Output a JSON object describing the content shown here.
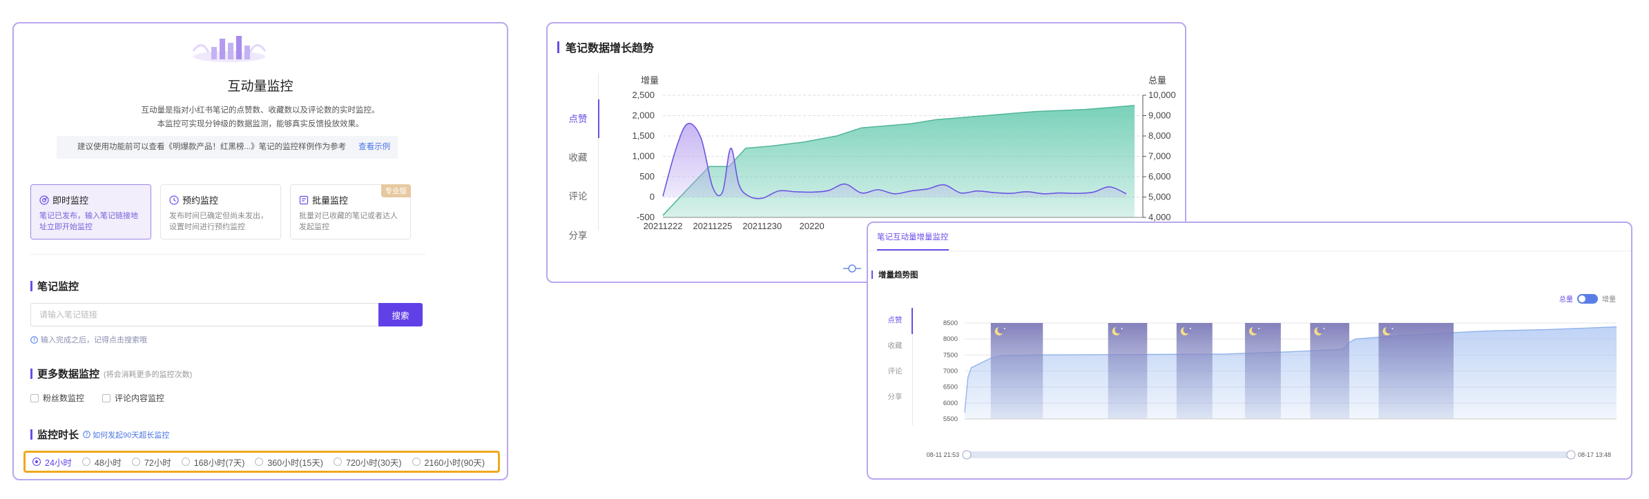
{
  "colors": {
    "accent": "#6240e8",
    "border": "#b9a6ee",
    "highlight": "#f0a81e",
    "link": "#4a76e6",
    "teal": "#5bbfa6"
  },
  "left": {
    "logo_icon": "bar-chart-logo-icon",
    "title": "互动量监控",
    "desc1": "互动量是指对小红书笔记的点赞数、收藏数以及评论数的实时监控。",
    "desc2": "本监控可实现分钟级的数据监测，能够真实反馈投放效果。",
    "tip": "建议使用功能前可以查看《明爆款产品！红黑榜...》笔记的监控样例作为参考",
    "tip_link": "查看示例",
    "modes": [
      {
        "title": "即时监控",
        "desc1": "笔记已发布，输入笔记链接地",
        "desc2": "址立即开始监控",
        "icon": "radar-icon"
      },
      {
        "title": "预约监控",
        "desc1": "发布时间已确定但尚未发出，",
        "desc2": "设置时间进行预约监控",
        "icon": "clock-icon"
      },
      {
        "title": "批量监控",
        "desc1": "批量对已收藏的笔记或者达人",
        "desc2": "发起监控",
        "icon": "batch-icon",
        "badge": "专业版"
      }
    ],
    "note_section": "笔记监控",
    "search_placeholder": "请输入笔记链接",
    "search_button": "搜索",
    "search_hint": "输入完成之后，记得点击搜索哦",
    "more_section": "更多数据监控",
    "more_sub": "(将会消耗更多的监控次数)",
    "checks": [
      "粉丝数监控",
      "评论内容监控"
    ],
    "duration_section": "监控时长",
    "duration_help": "如何发起90天超长监控",
    "durations": [
      "24小时",
      "48小时",
      "72小时",
      "168小时(7天)",
      "360小时(15天)",
      "720小时(30天)",
      "2160小时(90天)"
    ],
    "duration_selected": 0
  },
  "mid": {
    "title": "笔记数据增长趋势",
    "tabs": [
      "点赞",
      "收藏",
      "评论",
      "分享"
    ],
    "active_tab": 0
  },
  "right": {
    "tab": "笔记互动量增量监控",
    "title": "增量趋势图",
    "toggle_left": "总量",
    "toggle_right": "增量",
    "tabs": [
      "点赞",
      "收藏",
      "评论",
      "分享"
    ],
    "active_tab": 0,
    "slider_start": "08-11 21:53",
    "slider_end": "08-17 13:48"
  },
  "chart_data": [
    {
      "type": "area",
      "title": "笔记数据增长趋势",
      "ylabel": "增量",
      "y2label": "总量",
      "ylim": [
        -500,
        2500
      ],
      "y2lim": [
        4000,
        10000
      ],
      "yticks": [
        -500,
        0,
        500,
        1000,
        1500,
        2000,
        2500
      ],
      "y2ticks": [
        4000,
        5000,
        6000,
        7000,
        8000,
        9000,
        10000
      ],
      "xticks": [
        "20211222",
        "20211225",
        "20211230",
        "20220"
      ],
      "xlim": [
        0,
        29
      ],
      "xtick_positions": [
        0,
        3,
        6,
        9
      ],
      "series": [
        {
          "name": "增量",
          "axis": "left",
          "x": [
            0,
            0.8,
            1.5,
            2.3,
            3.0,
            3.6,
            4.1,
            4.6,
            5.2,
            6.0,
            7.0,
            8.0,
            9.0,
            10.0,
            11.0,
            12.0,
            13.0,
            14.0,
            15.0,
            16.0,
            17.0,
            18.0,
            19.0,
            20.0,
            21.0,
            22.0,
            23.0,
            24.0,
            25.0,
            26.0,
            27.0,
            28.0
          ],
          "values": [
            20,
            1200,
            1800,
            1450,
            250,
            120,
            1200,
            300,
            20,
            -30,
            150,
            130,
            120,
            160,
            320,
            100,
            180,
            80,
            150,
            200,
            300,
            100,
            150,
            110,
            90,
            130,
            80,
            100,
            90,
            120,
            250,
            80
          ]
        },
        {
          "name": "总量",
          "axis": "right",
          "x": [
            0,
            1.5,
            2.8,
            4.0,
            5.0,
            6.5,
            8.5,
            10.5,
            12.0,
            13.5,
            15.0,
            16.5,
            18.0,
            19.5,
            21.0,
            22.5,
            24.0,
            25.5,
            27.0,
            28.5
          ],
          "values": [
            4100,
            5400,
            6500,
            6500,
            7400,
            7500,
            7700,
            8000,
            8400,
            8500,
            8600,
            8800,
            8900,
            9000,
            9100,
            9200,
            9250,
            9300,
            9400,
            9500
          ]
        }
      ]
    },
    {
      "type": "area",
      "title": "增量趋势图",
      "ylim": [
        5500,
        8500
      ],
      "yticks": [
        5500,
        6000,
        6500,
        7000,
        7500,
        8000,
        8500
      ],
      "xlim": [
        0,
        100
      ],
      "night_bands": [
        [
          4,
          12
        ],
        [
          22,
          28
        ],
        [
          32.5,
          38
        ],
        [
          43,
          48.5
        ],
        [
          53,
          59
        ],
        [
          63.5,
          75
        ]
      ],
      "series": [
        {
          "name": "总量",
          "x": [
            0,
            0.5,
            1,
            2,
            3,
            4,
            5,
            6,
            10,
            20,
            30,
            40,
            50,
            58,
            59,
            60,
            63,
            70,
            80,
            90,
            100
          ],
          "values": [
            5700,
            6800,
            7100,
            7200,
            7300,
            7400,
            7450,
            7480,
            7500,
            7510,
            7520,
            7530,
            7600,
            7680,
            7900,
            8000,
            8050,
            8150,
            8250,
            8300,
            8380
          ]
        }
      ]
    }
  ]
}
